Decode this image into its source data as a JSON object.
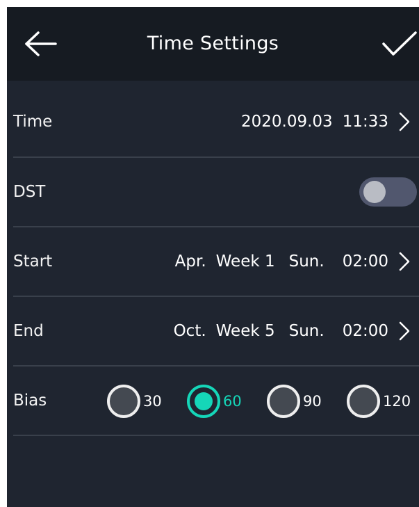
{
  "header": {
    "title": "Time Settings",
    "back_icon": "arrow-left-icon",
    "confirm_icon": "checkmark-icon"
  },
  "rows": {
    "time": {
      "label": "Time",
      "date": "2020.09.03",
      "clock": "11:33"
    },
    "dst": {
      "label": "DST",
      "enabled": false
    },
    "start": {
      "label": "Start",
      "month": "Apr.",
      "week": "Week 1",
      "day": "Sun.",
      "time": "02:00"
    },
    "end": {
      "label": "End",
      "month": "Oct.",
      "week": "Week 5",
      "day": "Sun.",
      "time": "02:00"
    },
    "bias": {
      "label": "Bias",
      "options": [
        "30",
        "60",
        "90",
        "120"
      ],
      "selected": "60"
    }
  },
  "colors": {
    "background": "#1f2530",
    "header": "#161b22",
    "accent": "#15d6b8",
    "divider": "#39404b",
    "toggle_track": "#51576e"
  }
}
